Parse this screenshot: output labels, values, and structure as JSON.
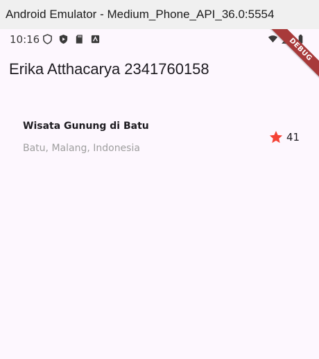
{
  "window": {
    "title": "Android Emulator - Medium_Phone_API_36.0:5554"
  },
  "status_bar": {
    "time": "10:16",
    "left_icons": [
      "shield-icon",
      "play-protect-icon",
      "sd-card-icon",
      "assistant-icon"
    ],
    "right_icons": [
      "wifi-icon",
      "cell-signal-icon",
      "battery-icon"
    ],
    "debug_banner": "DEBUG"
  },
  "app_bar": {
    "title": "Erika Atthacarya 2341760158"
  },
  "place": {
    "name": "Wisata Gunung di Batu",
    "location": "Batu, Malang, Indonesia",
    "rating_count": "41",
    "star_icon": "star-icon",
    "star_color": "#f44336"
  },
  "colors": {
    "background": "#fdf7fe",
    "titlebar": "#f0f0f0",
    "debug_ribbon": "#a83a3a",
    "secondary_text": "#9e9e9e"
  }
}
